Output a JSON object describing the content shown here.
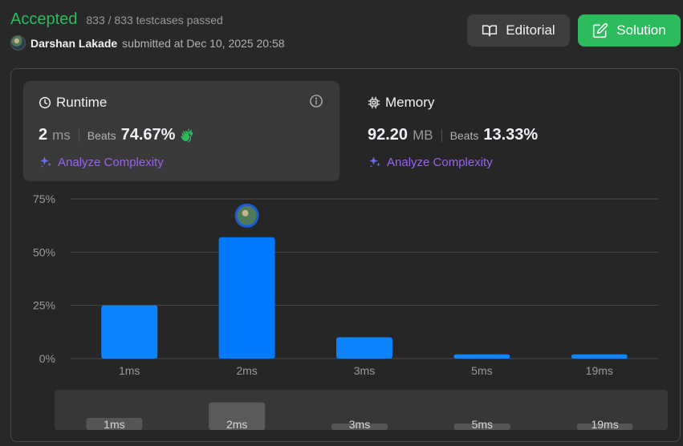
{
  "header": {
    "status": "Accepted",
    "testcases": "833 / 833 testcases passed",
    "username": "Darshan Lakade",
    "submitted_text": "submitted at Dec 10, 2025 20:58"
  },
  "buttons": {
    "editorial": "Editorial",
    "solution": "Solution"
  },
  "runtime": {
    "title": "Runtime",
    "value": "2",
    "unit": "ms",
    "beats_label": "Beats",
    "beats_pct": "74.67%",
    "analyze": "Analyze Complexity"
  },
  "memory": {
    "title": "Memory",
    "value": "92.20",
    "unit": "MB",
    "beats_label": "Beats",
    "beats_pct": "13.33%",
    "analyze": "Analyze Complexity"
  },
  "colors": {
    "accepted": "#2cbb5d",
    "bar": "#0a84ff",
    "bar_selected": "#007aff",
    "analyze": "#9a63f2"
  },
  "chart_data": {
    "type": "bar",
    "categories": [
      "1ms",
      "2ms",
      "3ms",
      "5ms",
      "19ms"
    ],
    "values": [
      25,
      57,
      10,
      2,
      2
    ],
    "ylim": [
      0,
      75
    ],
    "yticks": [
      "0%",
      "25%",
      "50%",
      "75%"
    ],
    "selected": "2ms",
    "grid": true
  },
  "navigator": {
    "labels": [
      "1ms",
      "2ms",
      "3ms",
      "5ms",
      "19ms"
    ],
    "selected": "2ms"
  }
}
